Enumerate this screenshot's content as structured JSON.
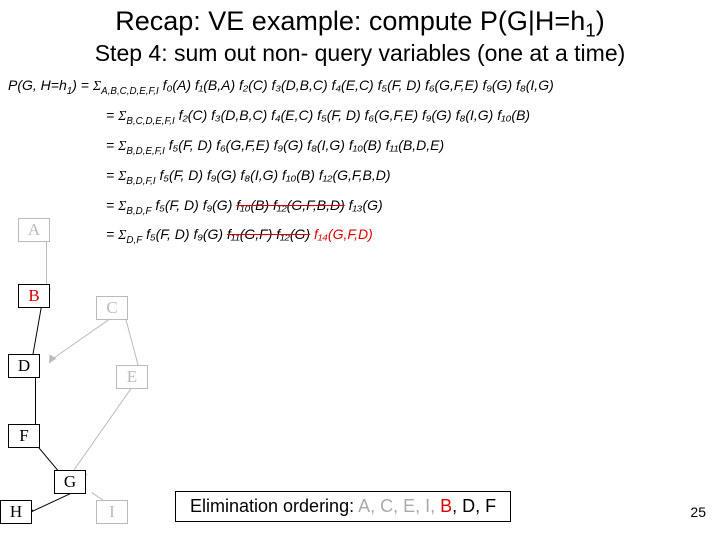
{
  "title_pre": "Recap: VE example: compute ",
  "title_expr": "P(G|H=h",
  "title_sub": "1",
  "title_post": ")",
  "subtitle": "Step 4: sum out non- query variables (one at a time)",
  "lhs": "P(G, H=h",
  "eq_lines": [
    {
      "prefix_sub": "A,B,C,D,E,F,I",
      "body": "f₀(A) f₁(B,A) f₂(C) f₃(D,B,C) f₄(E,C) f₅(F, D) f₆(G,F,E) f₉(G) f₈(I,G)",
      "strike": false
    },
    {
      "prefix_sub": "B,C,D,E,F,I",
      "body": "f₂(C) f₃(D,B,C) f₄(E,C) f₅(F, D) f₆(G,F,E) f₉(G) f₈(I,G) f₁₀(B)",
      "strike": false
    },
    {
      "prefix_sub": "B,D,E,F,I",
      "body": "f₅(F, D) f₆(G,F,E) f₉(G) f₈(I,G) f₁₀(B) f₁₁(B,D,E)",
      "strike": false
    },
    {
      "prefix_sub": "B,D,F,I",
      "body": "f₅(F, D) f₉(G) f₈(I,G) f₁₀(B) f₁₂(G,F,B,D)",
      "strike": false
    },
    {
      "prefix_sub": "B,D,F",
      "body_parts": [
        {
          "t": "f₅(F, D) f₉(G) ",
          "s": false
        },
        {
          "t": "f₁₀(B) f₁₂(G,F,B,D)",
          "s": true
        },
        {
          "t": " f₁₃(G)",
          "s": false
        }
      ]
    },
    {
      "prefix_sub": "D,F",
      "body_parts": [
        {
          "t": "f₅(F, D) f₉(G) ",
          "s": false
        },
        {
          "t": "f₁₁(G,F) f₁₂(G)",
          "s": true
        },
        {
          "t": " ",
          "s": false
        },
        {
          "t": "f₁₄(G,F,D)",
          "red": true
        }
      ]
    }
  ],
  "nodes": {
    "A": "A",
    "B": "B",
    "C": "C",
    "D": "D",
    "E": "E",
    "F": "F",
    "G": "G",
    "H": "H",
    "I": "I"
  },
  "footer_label": "Elimination ordering: ",
  "footer_gray": "A, C, E, I, ",
  "footer_red": "B",
  "footer_rest": ", D, F",
  "page": "25"
}
